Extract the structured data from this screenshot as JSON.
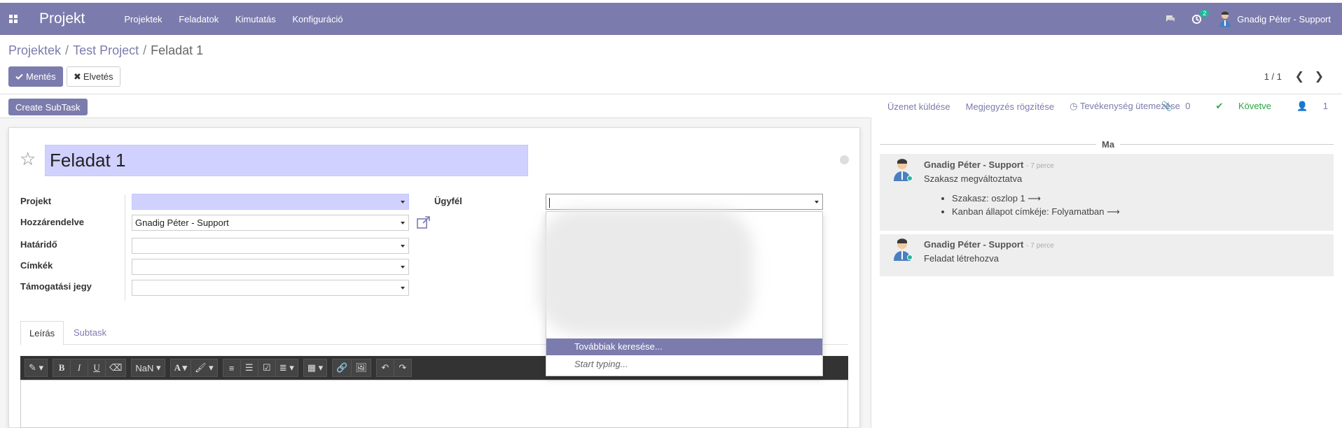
{
  "navbar": {
    "brand": "Projekt",
    "menu": [
      "Projektek",
      "Feladatok",
      "Kimutatás",
      "Konfiguráció"
    ],
    "activity_count": "2",
    "user_name": "Gnadig Péter - Support"
  },
  "breadcrumb": {
    "items": [
      "Projektek",
      "Test Project"
    ],
    "current": "Feladat 1"
  },
  "buttons": {
    "save": "Mentés",
    "discard": "Elvetés",
    "create_subtask": "Create SubTask"
  },
  "pager": {
    "value": "1 / 1"
  },
  "form": {
    "title": "Feladat 1",
    "fields": {
      "project_label": "Projekt",
      "project_value": "",
      "assignee_label": "Hozzárendelve",
      "assignee_value": "Gnadig Péter - Support",
      "deadline_label": "Határidő",
      "deadline_value": "",
      "tags_label": "Címkék",
      "tags_value": "",
      "ticket_label": "Támogatási jegy",
      "ticket_value": "",
      "customer_label": "Ügyfél",
      "customer_value": ""
    },
    "tabs": [
      "Leírás",
      "Subtask"
    ],
    "toolbar": {
      "font_size": "NaN"
    }
  },
  "dropdown": {
    "search_more": "Továbbiak keresése...",
    "hint": "Start typing..."
  },
  "chatter": {
    "send_message": "Üzenet küldése",
    "log_note": "Megjegyzés rögzítése",
    "schedule_activity": "Tevékenység ütemezése",
    "attachments": "0",
    "following": "Követve",
    "followers": "1",
    "day_label": "Ma",
    "messages": [
      {
        "author": "Gnadig Péter - Support",
        "when": "- 7 perce",
        "text": "Szakasz megváltoztatva",
        "tracking": [
          "Szakasz: oszlop 1 ⟶",
          "Kanban állapot címkéje: Folyamatban ⟶"
        ]
      },
      {
        "author": "Gnadig Péter - Support",
        "when": "- 7 perce",
        "text": "Feladat létrehozva"
      }
    ]
  },
  "colors": {
    "primary": "#7c7bad",
    "highlight": "#d1d1ff",
    "online": "#21b799",
    "follow": "#28a745"
  }
}
